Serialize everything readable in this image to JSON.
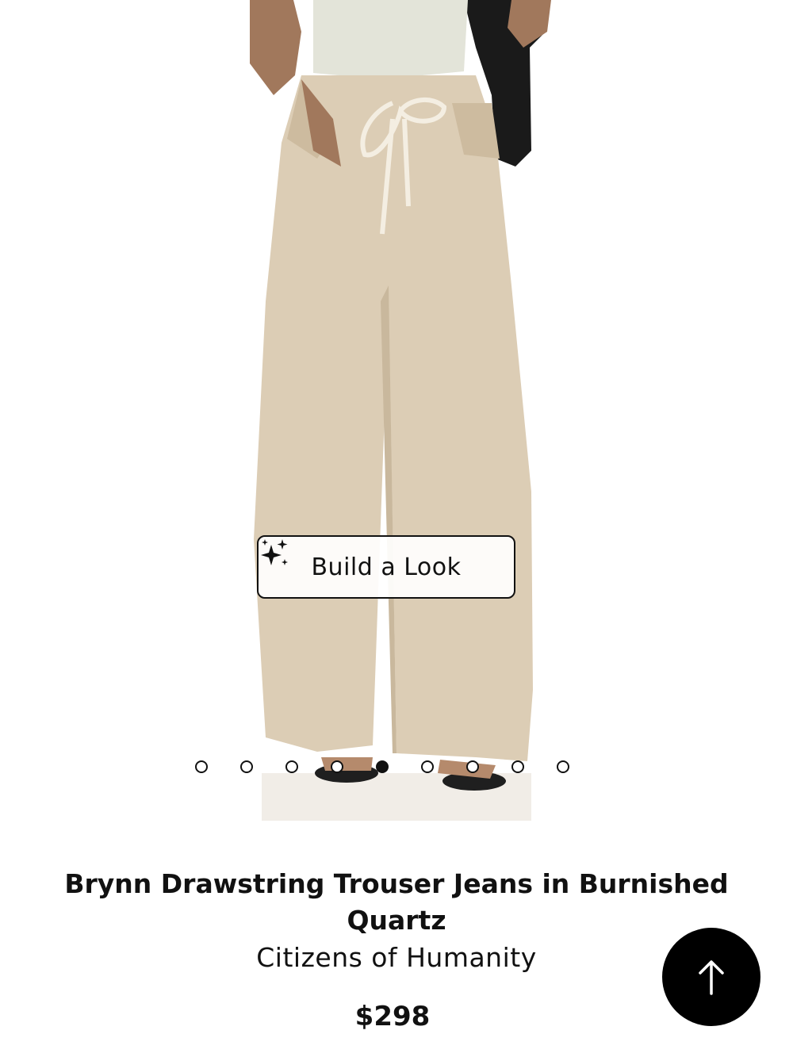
{
  "product": {
    "image_alt": "Model wearing beige wide-leg drawstring trouser jeans",
    "build_look_label": "Build a Look",
    "carousel": {
      "total": 9,
      "active_index": 4
    },
    "title": "Brynn Drawstring Trouser Jeans in Burnished Quartz",
    "brand": "Citizens of Humanity",
    "price": "$298"
  },
  "icons": {
    "build_look": "sparkle-icon",
    "scroll_top": "arrow-up-icon"
  },
  "colors": {
    "denim": "#dccdb5",
    "denim_shadow": "#c9b89d",
    "top": "#e3e4d9",
    "skin": "#a1785c",
    "accent": "#000000"
  }
}
